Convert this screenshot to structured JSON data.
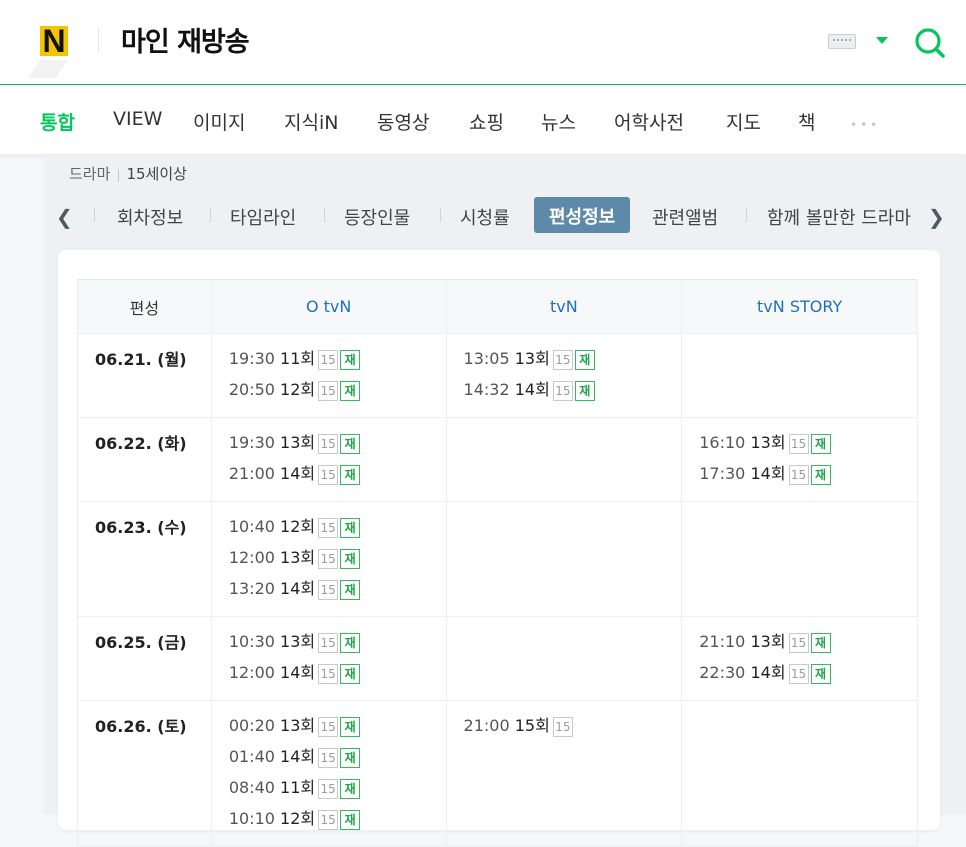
{
  "header": {
    "logo_letter": "N",
    "query": "마인 재방송"
  },
  "nav": {
    "items": [
      "통합",
      "VIEW",
      "이미지",
      "지식iN",
      "동영상",
      "쇼핑",
      "뉴스",
      "어학사전",
      "지도",
      "책"
    ],
    "more": "•••"
  },
  "breadcrumb": {
    "genre": "드라마",
    "age": "15세이상"
  },
  "tabs": [
    "회차정보",
    "타임라인",
    "등장인물",
    "시청률",
    "편성정보",
    "관련앨범",
    "함께 볼만한 드라마"
  ],
  "active_tab": "편성정보",
  "schedule": {
    "header": [
      "편성",
      "O tvN",
      "tvN",
      "tvN STORY"
    ],
    "badges": {
      "age": "15",
      "rerun": "재"
    },
    "rows": [
      {
        "date": "06.21. (월)",
        "cols": [
          [
            {
              "time": "19:30",
              "ep": "11회",
              "re": true
            },
            {
              "time": "20:50",
              "ep": "12회",
              "re": true
            }
          ],
          [
            {
              "time": "13:05",
              "ep": "13회",
              "re": true
            },
            {
              "time": "14:32",
              "ep": "14회",
              "re": true
            }
          ],
          []
        ]
      },
      {
        "date": "06.22. (화)",
        "cols": [
          [
            {
              "time": "19:30",
              "ep": "13회",
              "re": true
            },
            {
              "time": "21:00",
              "ep": "14회",
              "re": true
            }
          ],
          [],
          [
            {
              "time": "16:10",
              "ep": "13회",
              "re": true
            },
            {
              "time": "17:30",
              "ep": "14회",
              "re": true
            }
          ]
        ]
      },
      {
        "date": "06.23. (수)",
        "cols": [
          [
            {
              "time": "10:40",
              "ep": "12회",
              "re": true
            },
            {
              "time": "12:00",
              "ep": "13회",
              "re": true
            },
            {
              "time": "13:20",
              "ep": "14회",
              "re": true
            }
          ],
          [],
          []
        ]
      },
      {
        "date": "06.25. (금)",
        "cols": [
          [
            {
              "time": "10:30",
              "ep": "13회",
              "re": true
            },
            {
              "time": "12:00",
              "ep": "14회",
              "re": true
            }
          ],
          [],
          [
            {
              "time": "21:10",
              "ep": "13회",
              "re": true
            },
            {
              "time": "22:30",
              "ep": "14회",
              "re": true
            }
          ]
        ]
      },
      {
        "date": "06.26. (토)",
        "cols": [
          [
            {
              "time": "00:20",
              "ep": "13회",
              "re": true
            },
            {
              "time": "01:40",
              "ep": "14회",
              "re": true
            },
            {
              "time": "08:40",
              "ep": "11회",
              "re": true
            },
            {
              "time": "10:10",
              "ep": "12회",
              "re": true
            }
          ],
          [
            {
              "time": "21:00",
              "ep": "15회",
              "re": false
            }
          ],
          []
        ]
      }
    ]
  },
  "colors": {
    "brand_green": "#03c75a",
    "logo_yellow": "#f5c400",
    "active_tab_bg": "#5c8aa8",
    "channel_blue": "#1f6fc1"
  },
  "icons": {
    "search": "search-icon",
    "keyboard": "keyboard-icon"
  }
}
